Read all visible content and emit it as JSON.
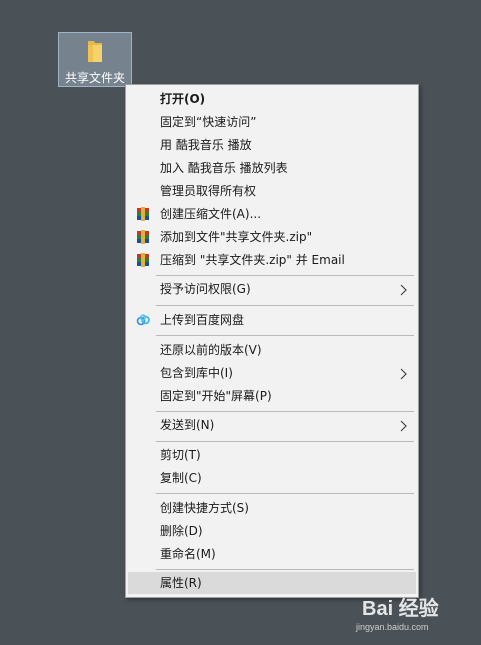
{
  "desktop": {
    "folder_name": "共享文件夹"
  },
  "menu": {
    "items": [
      {
        "label": "打开(O)"
      },
      {
        "label": "固定到“快速访问”"
      },
      {
        "label": "用 酷我音乐 播放"
      },
      {
        "label": "加入 酷我音乐 播放列表"
      },
      {
        "label": "管理员取得所有权"
      },
      {
        "label": "创建压缩文件(A)..."
      },
      {
        "label": "添加到文件\"共享文件夹.zip\""
      },
      {
        "label": "压缩到 \"共享文件夹.zip\" 并 Email"
      },
      {
        "label": "授予访问权限(G)"
      },
      {
        "label": "上传到百度网盘"
      },
      {
        "label": "还原以前的版本(V)"
      },
      {
        "label": "包含到库中(I)"
      },
      {
        "label": "固定到\"开始\"屏幕(P)"
      },
      {
        "label": "发送到(N)"
      },
      {
        "label": "剪切(T)"
      },
      {
        "label": "复制(C)"
      },
      {
        "label": "创建快捷方式(S)"
      },
      {
        "label": "删除(D)"
      },
      {
        "label": "重命名(M)"
      },
      {
        "label": "属性(R)"
      }
    ]
  },
  "watermark": {
    "logo": "Bai 经验",
    "site": "jingyan.baidu.com"
  },
  "icons": {
    "folder": "folder-icon",
    "archive": "winrar-archive-icon",
    "cloud": "baidu-netdisk-icon",
    "submenu": "chevron-right-icon"
  },
  "colors": {
    "desktop": "#4b5257",
    "menu_bg": "#f2f2f2",
    "hover": "#dadada",
    "folder": "#f1c75a"
  }
}
